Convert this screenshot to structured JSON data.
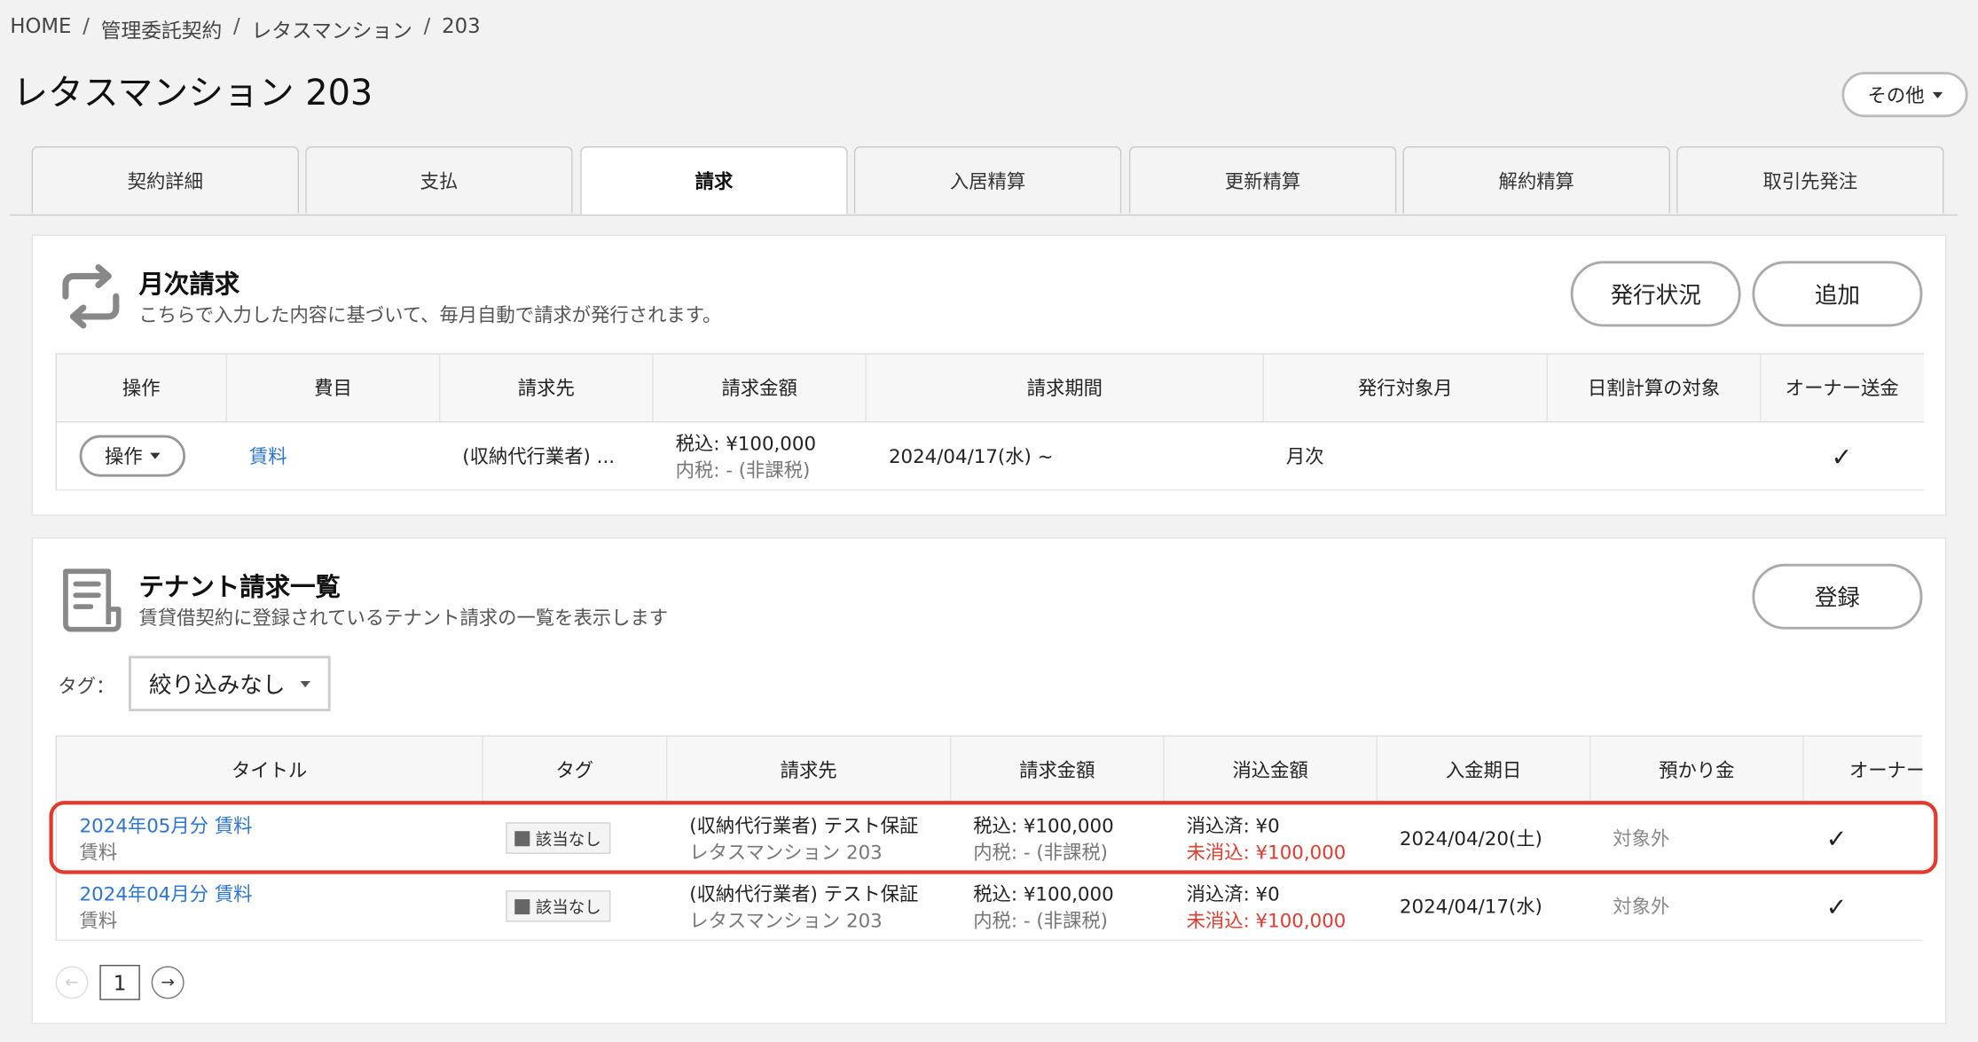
{
  "breadcrumb": [
    "HOME",
    "管理委託契約",
    "レタスマンション",
    "203"
  ],
  "page_title": "レタスマンション 203",
  "more_button": "その他",
  "tabs": [
    {
      "label": "契約詳細",
      "active": false
    },
    {
      "label": "支払",
      "active": false
    },
    {
      "label": "請求",
      "active": true
    },
    {
      "label": "入居精算",
      "active": false
    },
    {
      "label": "更新精算",
      "active": false
    },
    {
      "label": "解約精算",
      "active": false
    },
    {
      "label": "取引先発注",
      "active": false
    }
  ],
  "monthly": {
    "title": "月次請求",
    "desc": "こちらで入力した内容に基づいて、毎月自動で請求が発行されます。",
    "status_button": "発行状況",
    "add_button": "追加",
    "headers": [
      "操作",
      "費目",
      "請求先",
      "請求金額",
      "請求期間",
      "発行対象月",
      "日割計算の対象",
      "オーナー送金"
    ],
    "rows": [
      {
        "op_label": "操作",
        "item": "賃料",
        "payee": "(収納代行業者) ...",
        "amount": "税込: ¥100,000",
        "tax": "内税: - (非課税)",
        "period": "2024/04/17(水) ~",
        "target_month": "月次",
        "prorate": "",
        "owner": "✓"
      }
    ]
  },
  "tenant": {
    "title": "テナント請求一覧",
    "desc": "賃貸借契約に登録されているテナント請求の一覧を表示します",
    "register_button": "登録",
    "filter_label": "タグ：",
    "filter_value": "絞り込みなし",
    "headers": [
      "タイトル",
      "タグ",
      "請求先",
      "請求金額",
      "消込金額",
      "入金期日",
      "預かり金",
      "オーナー"
    ],
    "rows": [
      {
        "title": "2024年05月分 賃料",
        "subtitle": "賃料",
        "tag": "該当なし",
        "payee": "(収納代行業者) テスト保証",
        "payee_sub": "レタスマンション 203",
        "amount": "税込: ¥100,000",
        "tax": "内税: - (非課税)",
        "cleared": "消込済: ¥0",
        "uncleared": "未消込: ¥100,000",
        "due": "2024/04/20(土)",
        "deposit": "対象外",
        "owner": "✓"
      },
      {
        "title": "2024年04月分 賃料",
        "subtitle": "賃料",
        "tag": "該当なし",
        "payee": "(収納代行業者) テスト保証",
        "payee_sub": "レタスマンション 203",
        "amount": "税込: ¥100,000",
        "tax": "内税: - (非課税)",
        "cleared": "消込済: ¥0",
        "uncleared": "未消込: ¥100,000",
        "due": "2024/04/17(水)",
        "deposit": "対象外",
        "owner": "✓"
      }
    ],
    "pager": {
      "prev": "←",
      "page": "1",
      "next": "→"
    }
  },
  "colors": {
    "link": "#2b74d8",
    "alert": "#e23b2e",
    "highlight": "#e23b2e"
  }
}
